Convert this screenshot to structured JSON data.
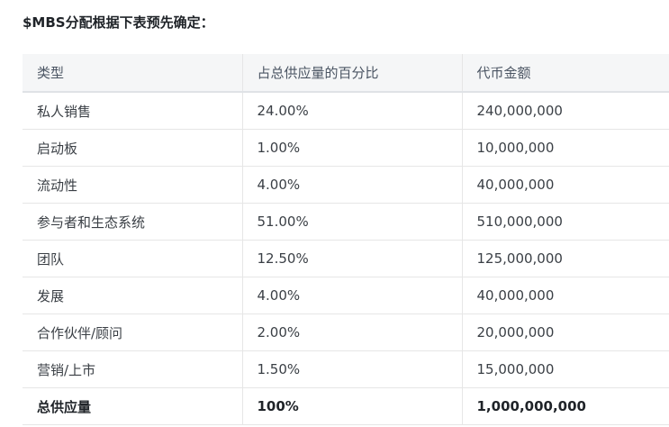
{
  "heading": "$MBS分配根据下表预先确定：",
  "table": {
    "headers": [
      "类型",
      "占总供应量的百分比",
      "代币金额"
    ],
    "rows": [
      [
        "私人销售",
        "24.00%",
        "240,000,000"
      ],
      [
        "启动板",
        "1.00%",
        "10,000,000"
      ],
      [
        "流动性",
        "4.00%",
        "40,000,000"
      ],
      [
        "参与者和生态系统",
        "51.00%",
        "510,000,000"
      ],
      [
        "团队",
        "12.50%",
        "125,000,000"
      ],
      [
        "发展",
        "4.00%",
        "40,000,000"
      ],
      [
        "合作伙伴/顾问",
        "2.00%",
        "20,000,000"
      ],
      [
        "营销/上市",
        "1.50%",
        "15,000,000"
      ],
      [
        "总供应量",
        "100%",
        "1,000,000,000"
      ]
    ]
  }
}
